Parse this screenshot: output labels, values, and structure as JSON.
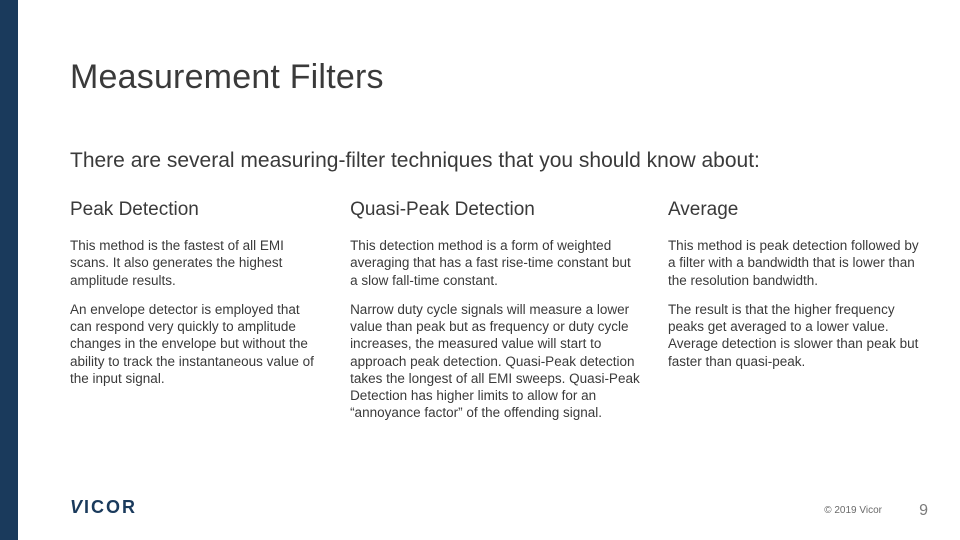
{
  "title": "Measurement Filters",
  "intro": "There are several measuring-filter techniques that you should know about:",
  "columns": [
    {
      "heading": "Peak Detection",
      "paragraphs": [
        "This method is the fastest of all EMI scans. It also generates the highest amplitude results.",
        "An envelope detector is employed that can respond very quickly to amplitude changes in the envelope but without the ability to track the instantaneous value of the input signal."
      ]
    },
    {
      "heading": "Quasi-Peak Detection",
      "paragraphs": [
        "This detection method is a form of weighted averaging that has a fast rise-time constant but a slow fall-time constant.",
        "Narrow duty cycle signals will measure a lower value than peak but as frequency or duty cycle increases, the measured value will start to approach peak detection. Quasi-Peak detection takes the longest of all EMI sweeps. Quasi-Peak Detection has higher limits to allow for an “annoyance factor” of the offending signal."
      ]
    },
    {
      "heading": "Average",
      "paragraphs": [
        "This method is peak detection followed by a filter with a bandwidth that is lower than the resolution bandwidth.",
        "The result is that the higher frequency peaks get averaged to a lower value. Average detection is slower than peak but faster than quasi-peak."
      ]
    }
  ],
  "footer": {
    "logo_text": "VICOR",
    "copyright": "© 2019 Vicor",
    "page_number": "9"
  }
}
